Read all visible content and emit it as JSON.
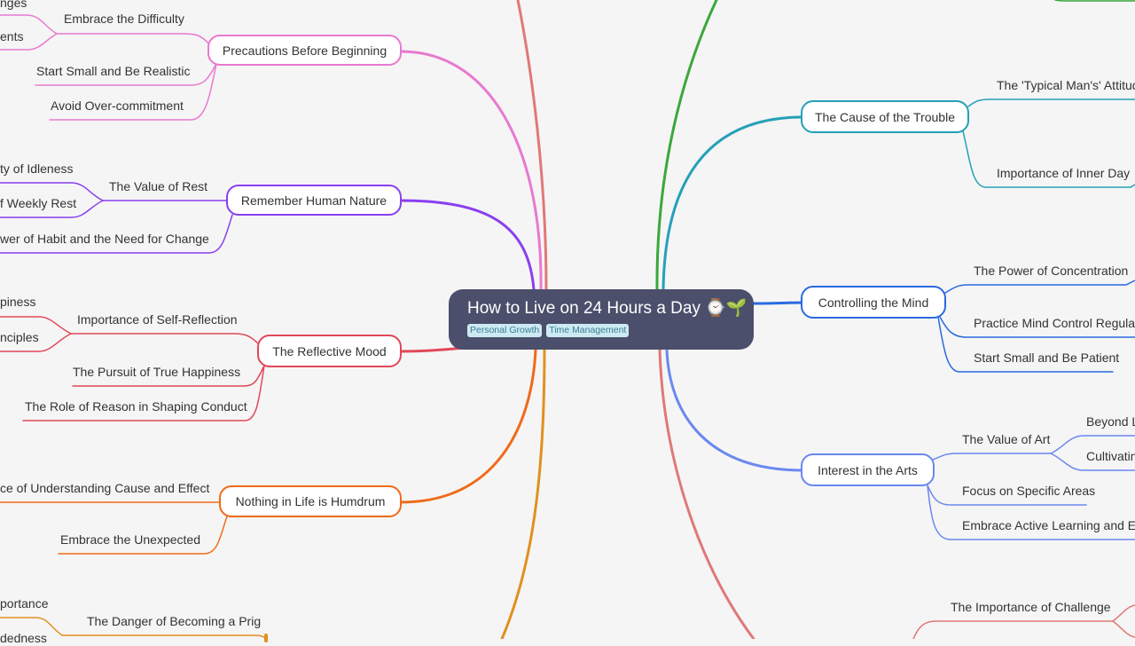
{
  "root": {
    "title": "How to Live on 24 Hours a Day ⌚🌱",
    "tags": [
      "Personal Growth",
      "Time Management"
    ]
  },
  "colors": {
    "background": "#f5f5f5",
    "root_fill": "#4b4f6b",
    "pink": "#e879d0",
    "purple": "#8a3ff0",
    "red": "#e04858",
    "orange": "#f06a1a",
    "amber": "#e09020",
    "salmon": "#e07878",
    "green": "#3aa83a",
    "teal": "#26a0b8",
    "blue": "#2a6ae0",
    "periwinkle": "#6a88f0"
  },
  "branches": {
    "precautions": {
      "label": "Precautions Before Beginning",
      "children": [
        "Embrace the Difficulty",
        "Start Small and Be Realistic",
        "Avoid Over-commitment"
      ],
      "grandchildren": [
        "nges",
        "ents"
      ]
    },
    "human_nature": {
      "label": "Remember Human Nature",
      "children": [
        "The Value of Rest",
        "wer of Habit and the Need for Change"
      ],
      "grandchildren": [
        "ty of Idleness",
        "f Weekly Rest"
      ]
    },
    "reflective": {
      "label": "The Reflective Mood",
      "children": [
        "Importance of Self-Reflection",
        "The Pursuit of True Happiness",
        "The Role of Reason in Shaping Conduct"
      ],
      "grandchildren": [
        "piness",
        "nciples"
      ]
    },
    "humdrum": {
      "label": "Nothing in Life is Humdrum",
      "children": [
        "ce of Understanding Cause and Effect",
        "Embrace the Unexpected"
      ]
    },
    "prig": {
      "children": [
        "The Danger of Becoming a Prig"
      ],
      "grandchildren": [
        "portance",
        "dedness"
      ]
    },
    "cause": {
      "label": "The Cause of the Trouble",
      "children": [
        "The 'Typical Man's' Attitud",
        "Importance of Inner Day"
      ]
    },
    "mind": {
      "label": "Controlling the Mind",
      "children": [
        "The Power of Concentration",
        "Practice Mind Control Regularly",
        "Start Small and Be Patient"
      ]
    },
    "arts": {
      "label": "Interest in the Arts",
      "children": [
        "The Value of Art",
        "Focus on Specific Areas",
        "Embrace Active Learning and Eng"
      ],
      "grandchildren": [
        "Beyond L",
        "Cultivatin"
      ]
    },
    "challenge": {
      "children": [
        "The Importance of Challenge"
      ]
    }
  }
}
